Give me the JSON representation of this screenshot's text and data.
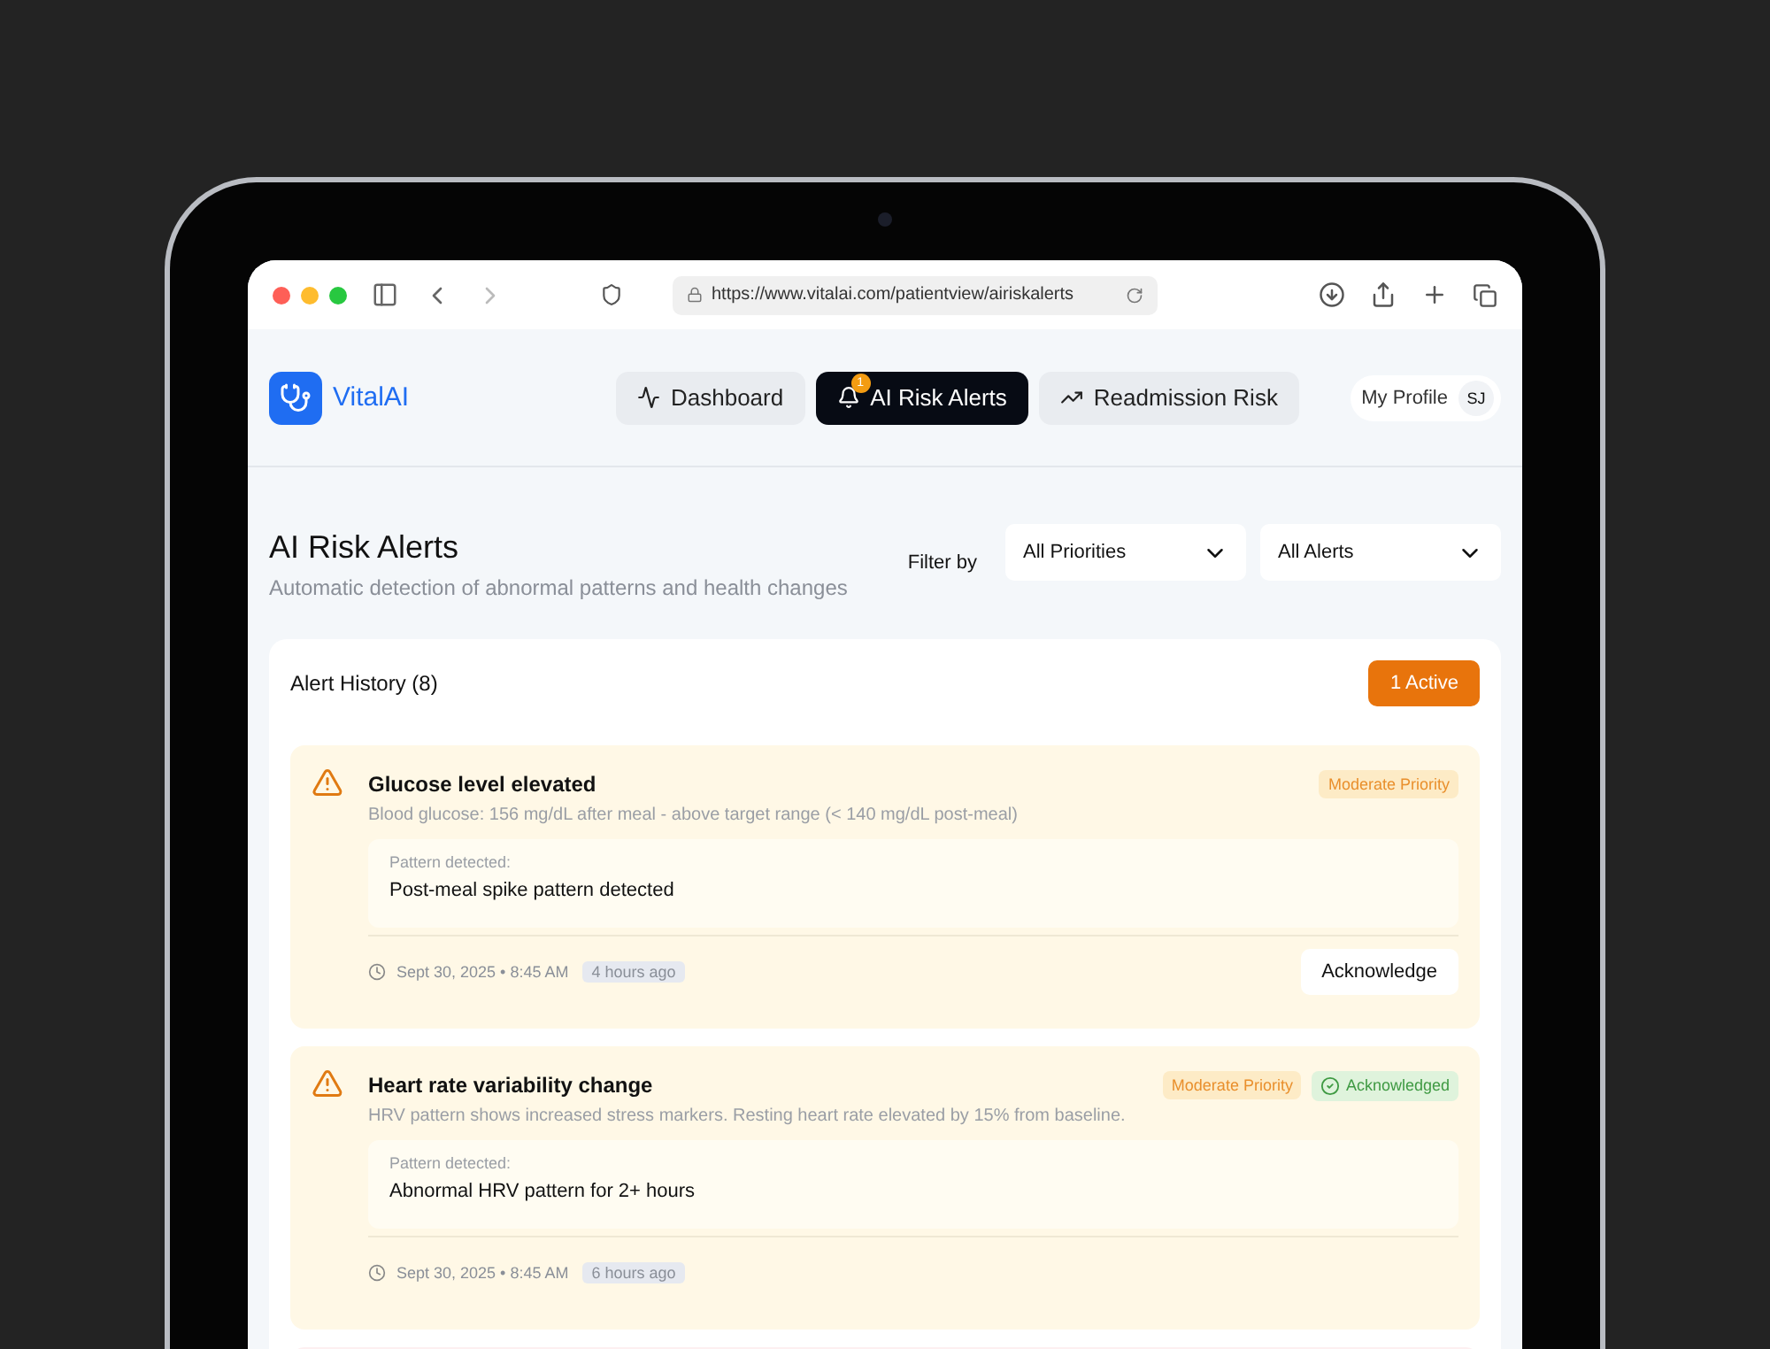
{
  "browser": {
    "url": "https://www.vitalai.com/patientview/airiskalerts"
  },
  "app": {
    "name": "VitalAI"
  },
  "nav": [
    {
      "label": "Dashboard",
      "kind": "pulse",
      "selected": false
    },
    {
      "label": "AI Risk Alerts",
      "kind": "bell",
      "selected": true,
      "badge": "1"
    },
    {
      "label": "Readmission Risk",
      "kind": "trend",
      "selected": false
    }
  ],
  "profile": {
    "label": "My Profile",
    "initials": "SJ"
  },
  "page": {
    "title": "AI Risk Alerts",
    "subtitle": "Automatic detection of abnormal patterns and health changes"
  },
  "filters": {
    "label": "Filter by",
    "selects": [
      "All Priorities",
      "All Alerts"
    ]
  },
  "history": {
    "title": "Alert History (8)",
    "active_button": "1 Active"
  },
  "alerts": [
    {
      "title": "Glucose level elevated",
      "description": "Blood glucose: 156 mg/dL after meal - above target range (< 140 mg/dL post-meal)",
      "pattern_label": "Pattern detected:",
      "pattern": "Post-meal spike pattern detected",
      "date": "Sept 30, 2025 • 8:45 AM",
      "ago": "4 hours ago",
      "badges": [
        {
          "label": "Moderate Priority",
          "kind": "priority"
        }
      ],
      "action": "Acknowledge"
    },
    {
      "title": "Heart rate variability change",
      "description": "HRV pattern shows increased stress markers. Resting heart rate elevated by 15% from baseline.",
      "pattern_label": "Pattern detected:",
      "pattern": "Abnormal HRV pattern for 2+ hours",
      "date": "Sept 30, 2025 • 8:45 AM",
      "ago": "6 hours ago",
      "badges": [
        {
          "label": "Moderate Priority",
          "kind": "priority"
        },
        {
          "label": "Acknowledged",
          "kind": "acknowledged"
        }
      ]
    }
  ]
}
